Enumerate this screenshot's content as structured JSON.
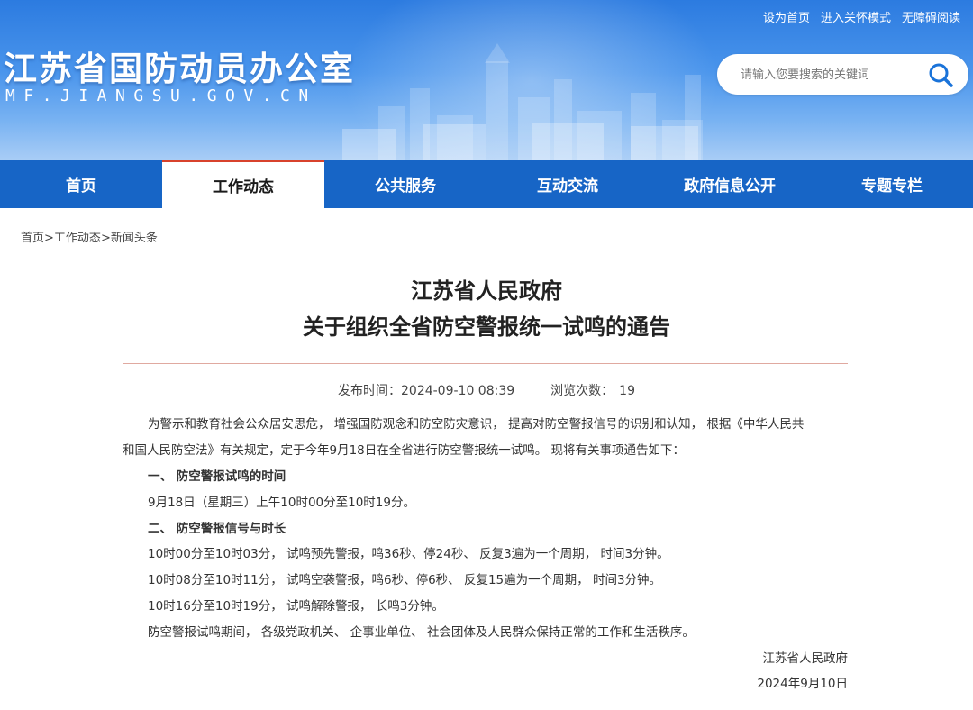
{
  "header": {
    "top_links": [
      "设为首页",
      "进入关怀模式",
      "无障碍阅读"
    ],
    "site_title": "江苏省国防动员办公室",
    "site_domain": "MF.JIANGSU.GOV.CN",
    "search": {
      "placeholder": "请输入您要搜索的关键词",
      "icon": "search-icon"
    }
  },
  "nav": {
    "items": [
      "首页",
      "工作动态",
      "公共服务",
      "互动交流",
      "政府信息公开",
      "专题专栏"
    ],
    "active": "工作动态"
  },
  "breadcrumb": {
    "home": "首页",
    "section": "工作动态",
    "page": "新闻头条",
    "separator": ">"
  },
  "article": {
    "title_line1": "江苏省人民政府",
    "title_line2": "关于组织全省防空警报统一试鸣的通告",
    "publish_label": "发布时间：",
    "publish_time": "2024-09-10 08:39",
    "views_label": "浏览次数：",
    "views": "19",
    "intro_line1": "为警示和教育社会公众居安思危， 增强国防观念和防空防灾意识， 提高对防空警报信号的识别和认知， 根据《中华人民共",
    "intro_line2": "和国人民防空法》有关规定，定于今年9月18日在全省进行防空警报统一试鸣。 现将有关事项通告如下：",
    "section1_title": "一、  防空警报试鸣的时间",
    "section1_text": "9月18日（星期三）上午10时00分至10时19分。",
    "section2_title": "二、  防空警报信号与时长",
    "signal1": "10时00分至10时03分， 试鸣预先警报，鸣36秒、停24秒、 反复3遍为一个周期， 时间3分钟。",
    "signal2": "10时08分至10时11分， 试鸣空袭警报，鸣6秒、停6秒、 反复15遍为一个周期， 时间3分钟。",
    "signal3": "10时16分至10时19分， 试鸣解除警报， 长鸣3分钟。",
    "closing": "防空警报试鸣期间， 各级党政机关、 企事业单位、 社会团体及人民群众保持正常的工作和生活秩序。",
    "signature": "江苏省人民政府",
    "date": "2024年9月10日"
  },
  "colors": {
    "nav_bg": "#1765c6",
    "active_tab_border": "#d8422c",
    "title_rule": "#e0a9a0"
  }
}
